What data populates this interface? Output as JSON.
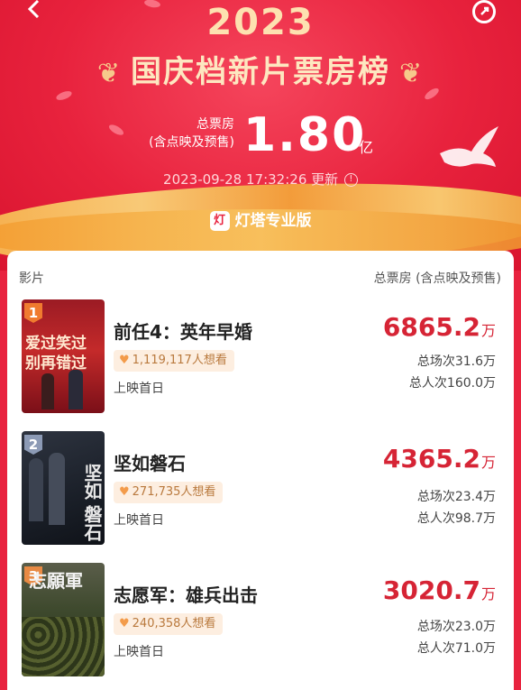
{
  "header": {
    "year": "2023",
    "title": "国庆档新片票房榜",
    "total_label_line1": "总票房",
    "total_label_line2": "(含点映及预售)",
    "total_value": "1.80",
    "total_unit": "亿",
    "updated_time": "2023-09-28 17:32:26",
    "updated_label": "更新",
    "brand": "灯塔专业版",
    "brand_logo_char": "灯"
  },
  "icons": {
    "back": "chevron-left-icon",
    "share": "share-icon",
    "info": "info-icon",
    "heart": "heart-icon",
    "dove": "dove-icon"
  },
  "colors": {
    "bg_red": "#e8233f",
    "box_red": "#d62435",
    "gold": "#fde1b0",
    "want_bg": "#fdeee0",
    "want_text": "#b9793d"
  },
  "columns": {
    "left": "影片",
    "right": "总票房 (含点映及预售)"
  },
  "movies": [
    {
      "rank": "1",
      "name": "前任4：英年早婚",
      "want": "1,119,117人想看",
      "release": "上映首日",
      "box": "6865.2",
      "box_unit": "万",
      "showings": "总场次31.6万",
      "viewers": "总人次160.0万",
      "poster_line1": "爱过笑过",
      "poster_line2": "别再错过"
    },
    {
      "rank": "2",
      "name": "坚如磐石",
      "want": "271,735人想看",
      "release": "上映首日",
      "box": "4365.2",
      "box_unit": "万",
      "showings": "总场次23.4万",
      "viewers": "总人次98.7万",
      "poster_line1": "坚如",
      "poster_line2": "磐石"
    },
    {
      "rank": "3",
      "name": "志愿军：雄兵出击",
      "want": "240,358人想看",
      "release": "上映首日",
      "box": "3020.7",
      "box_unit": "万",
      "showings": "总场次23.0万",
      "viewers": "总人次71.0万",
      "poster_line1": "志願軍",
      "poster_line2": ""
    }
  ]
}
